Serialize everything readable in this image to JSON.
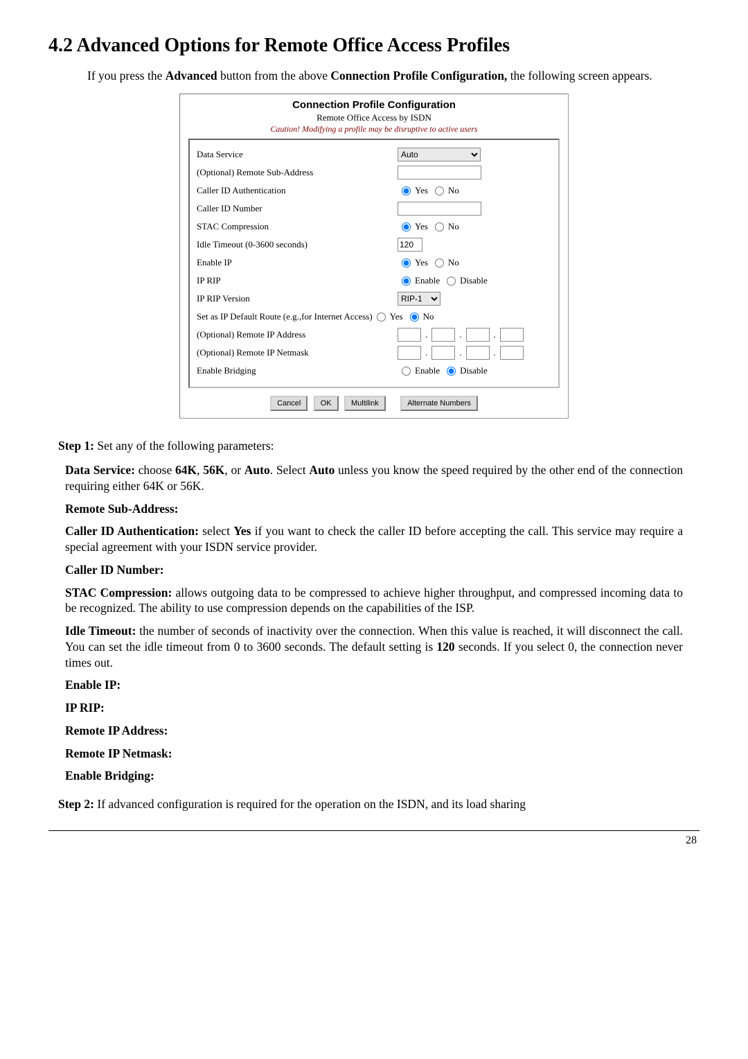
{
  "section_title": "4.2 Advanced Options for Remote Office Access Profiles",
  "intro": "If you press the Advanced button from the above Connection Profile Configuration, the following screen appears.",
  "dialog": {
    "title": "Connection Profile Configuration",
    "subtitle": "Remote Office Access by ISDN",
    "caution": "Caution! Modifying a profile may be disruptive to active users",
    "data_service_label": "Data Service",
    "data_service_value": "Auto",
    "remote_sub_label": "(Optional) Remote Sub-Address",
    "caller_auth_label": "Caller ID Authentication",
    "caller_num_label": "Caller ID Number",
    "stac_label": "STAC Compression",
    "idle_label": "Idle Timeout (0-3600 seconds)",
    "idle_value": "120",
    "enable_ip_label": "Enable IP",
    "ip_rip_label": "IP RIP",
    "ip_rip_ver_label": "IP RIP Version",
    "ip_rip_ver_value": "RIP-1",
    "default_route_label": "Set as IP Default Route (e.g.,for Internet Access)",
    "remote_ip_addr_label": "(Optional) Remote IP Address",
    "remote_ip_mask_label": "(Optional) Remote IP Netmask",
    "enable_bridging_label": "Enable Bridging",
    "yes": "Yes",
    "no": "No",
    "enable": "Enable",
    "disable": "Disable",
    "btn_cancel": "Cancel",
    "btn_ok": "OK",
    "btn_multilink": "Multilink",
    "btn_altnum": "Alternate Numbers"
  },
  "step1_label": "Step 1:",
  "step1_text": " Set any of the following parameters:",
  "ds_label": "Data Service:",
  "ds_text_a": " choose ",
  "ds_64": "64K",
  "ds_comma": ", ",
  "ds_56": "56K",
  "ds_or": ", or ",
  "ds_auto": "Auto",
  "ds_text_b": ". Select ",
  "ds_auto2": "Auto",
  "ds_text_c": " unless you know the speed required by the other end of the connection requiring either 64K or 56K.",
  "rsa_label": "Remote Sub-Address:",
  "cia_label": "Caller ID Authentication:",
  "cia_text_a": " select ",
  "cia_yes": "Yes",
  "cia_text_b": " if you want to check the caller ID before accepting the call. This service may require a special agreement with your ISDN service provider.",
  "cin_label": "Caller ID Number:",
  "stac_b_label": "STAC Compression:",
  "stac_text": " allows outgoing data to be compressed to achieve higher throughput, and compressed incoming data to be recognized. The ability to use compression depends on the capabilities of the ISP.",
  "idle_b_label": "Idle Timeout:",
  "idle_text_a": " the number of seconds of inactivity over the connection. When this value is reached, it will disconnect the call. You can set the idle timeout from 0 to 3600 seconds. The default setting is ",
  "idle_120": "120",
  "idle_text_b": " seconds. If you select 0, the connection never times out.",
  "eip_label": "Enable IP:",
  "iprip_label": "IP RIP:",
  "ripa_label": "Remote IP Address:",
  "ripm_label": "Remote IP Netmask:",
  "eb_label": "Enable Bridging:",
  "step2_label": "Step 2:",
  "step2_text": " If advanced configuration is required for the operation on the ISDN, and its load sharing",
  "pageno": "28"
}
